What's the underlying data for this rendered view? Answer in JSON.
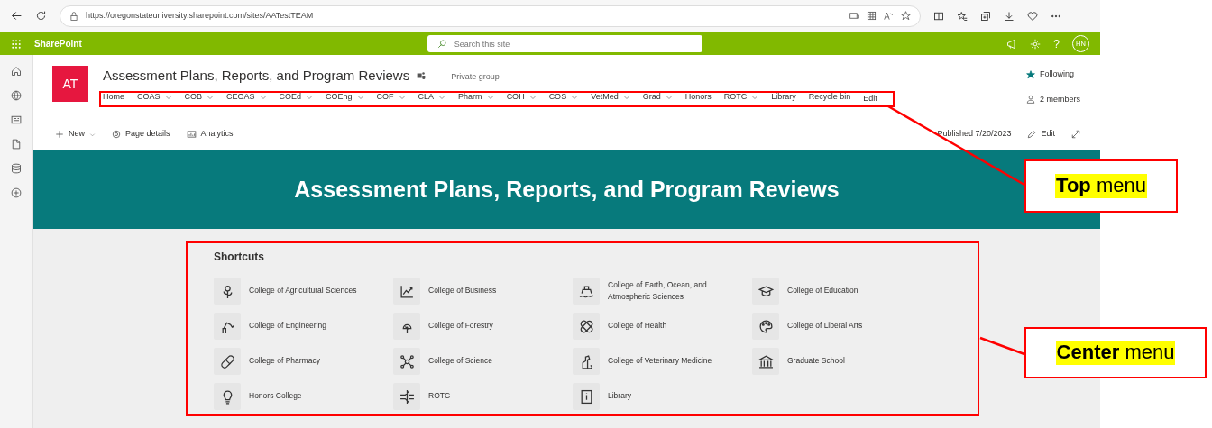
{
  "browser": {
    "url": "https://oregonstateuniversity.sharepoint.com/sites/AATestTEAM"
  },
  "suite_bar": {
    "app_name": "SharePoint",
    "search": {
      "placeholder": "Search this site"
    },
    "help": "?",
    "avatar": "HN"
  },
  "site": {
    "logo": "AT",
    "title": "Assessment Plans, Reports, and Program Reviews",
    "privacy": "Private group",
    "following": "Following",
    "members": "2 members"
  },
  "top_nav": {
    "items": [
      {
        "label": "Home",
        "dropdown": false
      },
      {
        "label": "COAS",
        "dropdown": true
      },
      {
        "label": "COB",
        "dropdown": true
      },
      {
        "label": "CEOAS",
        "dropdown": true
      },
      {
        "label": "COEd",
        "dropdown": true
      },
      {
        "label": "COEng",
        "dropdown": true
      },
      {
        "label": "COF",
        "dropdown": true
      },
      {
        "label": "CLA",
        "dropdown": true
      },
      {
        "label": "Pharm",
        "dropdown": true
      },
      {
        "label": "COH",
        "dropdown": true
      },
      {
        "label": "COS",
        "dropdown": true
      },
      {
        "label": "VetMed",
        "dropdown": true
      },
      {
        "label": "Grad",
        "dropdown": true
      },
      {
        "label": "Honors",
        "dropdown": false
      },
      {
        "label": "ROTC",
        "dropdown": true
      },
      {
        "label": "Library",
        "dropdown": false
      }
    ],
    "recycle_bin": "Recycle bin",
    "edit": "Edit"
  },
  "command_bar": {
    "new": "New",
    "page_details": "Page details",
    "analytics": "Analytics",
    "published": "Published 7/20/2023",
    "edit": "Edit"
  },
  "banner": {
    "title": "Assessment Plans, Reports, and Program Reviews"
  },
  "shortcuts": {
    "title": "Shortcuts",
    "items": [
      {
        "label": "College of Agricultural Sciences"
      },
      {
        "label": "College of Business"
      },
      {
        "label": "College of Earth, Ocean, and Atmospheric Sciences"
      },
      {
        "label": "College of Education"
      },
      {
        "label": "College of Engineering"
      },
      {
        "label": "College of Forestry"
      },
      {
        "label": "College of Health"
      },
      {
        "label": "College of Liberal Arts"
      },
      {
        "label": "College of Pharmacy"
      },
      {
        "label": "College of Science"
      },
      {
        "label": "College of Veterinary Medicine"
      },
      {
        "label": "Graduate School"
      },
      {
        "label": "Honors College"
      },
      {
        "label": "ROTC"
      },
      {
        "label": "Library"
      }
    ]
  },
  "annotations": [
    {
      "label": "**Top** menu"
    },
    {
      "label": "**Center** menu"
    }
  ]
}
